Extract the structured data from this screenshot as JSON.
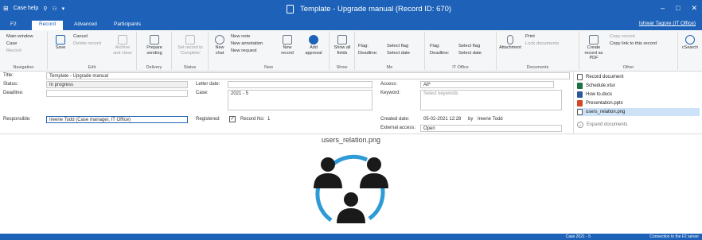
{
  "app": {
    "name": "Case help",
    "title": "Template - Upgrade manual (Record ID: 670)",
    "user": "Ishwar Tagore (IT Office)"
  },
  "tabs": [
    "F2",
    "Record",
    "Advanced",
    "Participants"
  ],
  "ribbon": {
    "navigation": {
      "main_window": "Main window",
      "case": "Case",
      "record": "Record",
      "label": "Navigation"
    },
    "edit": {
      "save": "Save",
      "cancel": "Cancel",
      "delete": "Delete record",
      "archive": "Archive and close",
      "label": "Edit"
    },
    "delivery": {
      "prepare": "Prepare sending",
      "label": "Delivery"
    },
    "status": {
      "set_complete": "Set record to 'Complete'",
      "label": "Status"
    },
    "new": {
      "new_chat": "New chat",
      "new_note": "New note",
      "new_annotation": "New annotation",
      "new_request": "New request",
      "new_record": "New record",
      "add_approval": "Add approval",
      "label": "New"
    },
    "show": {
      "show_all_fields": "Show all fields",
      "label": "Show"
    },
    "me": {
      "flag": "Flag:",
      "flag_value": "Select flag",
      "deadline": "Deadline:",
      "deadline_value": "Select date",
      "label": "Me"
    },
    "it_office": {
      "flag": "Flag:",
      "flag_value": "Select flag",
      "deadline": "Deadline:",
      "deadline_value": "Select date",
      "label": "IT Office"
    },
    "documents": {
      "attachment": "Attachment",
      "print": "Print",
      "lock": "Lock documents",
      "label": "Documents"
    },
    "other": {
      "create_pdf": "Create record as PDF",
      "copy_record": "Copy record",
      "copy_link": "Copy link to this record",
      "label": "Other"
    },
    "csearch": {
      "btn": "cSearch",
      "label": "cSearch"
    }
  },
  "form": {
    "title_label": "Title:",
    "title_value": "Template - Upgrade manual",
    "status_label": "Status:",
    "status_value": "In progress",
    "deadline_label": "Deadline:",
    "responsible_label": "Responsible:",
    "responsible_value": "Ireene Todd (Case manager, IT Office)",
    "letter_date_label": "Letter date:",
    "case_label": "Case:",
    "case_value": "2021 - 5",
    "registered_label": "Registered:",
    "record_no_label": "Record No:",
    "record_no_value": "1",
    "access_label": "Access:",
    "access_value": "All*",
    "keyword_label": "Keyword:",
    "keyword_placeholder": "Select keywords",
    "created_label": "Created date:",
    "created_value": "05-02-2021 12:28",
    "by_label": "by",
    "by_value": "Ireene Todd",
    "external_label": "External access:",
    "external_value": "Open"
  },
  "documents": {
    "items": [
      "Record document",
      "Schedule.xlsx",
      "How to.docx",
      "Presentation.pptx",
      "users_relation.png"
    ],
    "expand": "Expand documents"
  },
  "viewer": {
    "filename": "users_relation.png"
  },
  "statusbar": {
    "case": "Case 2021 - 5",
    "connection": "Connection to the F2 server"
  },
  "colors": {
    "brand": "#1d62b8",
    "accent": "#2e9bd6",
    "icon_dark": "#1a1a1a"
  }
}
